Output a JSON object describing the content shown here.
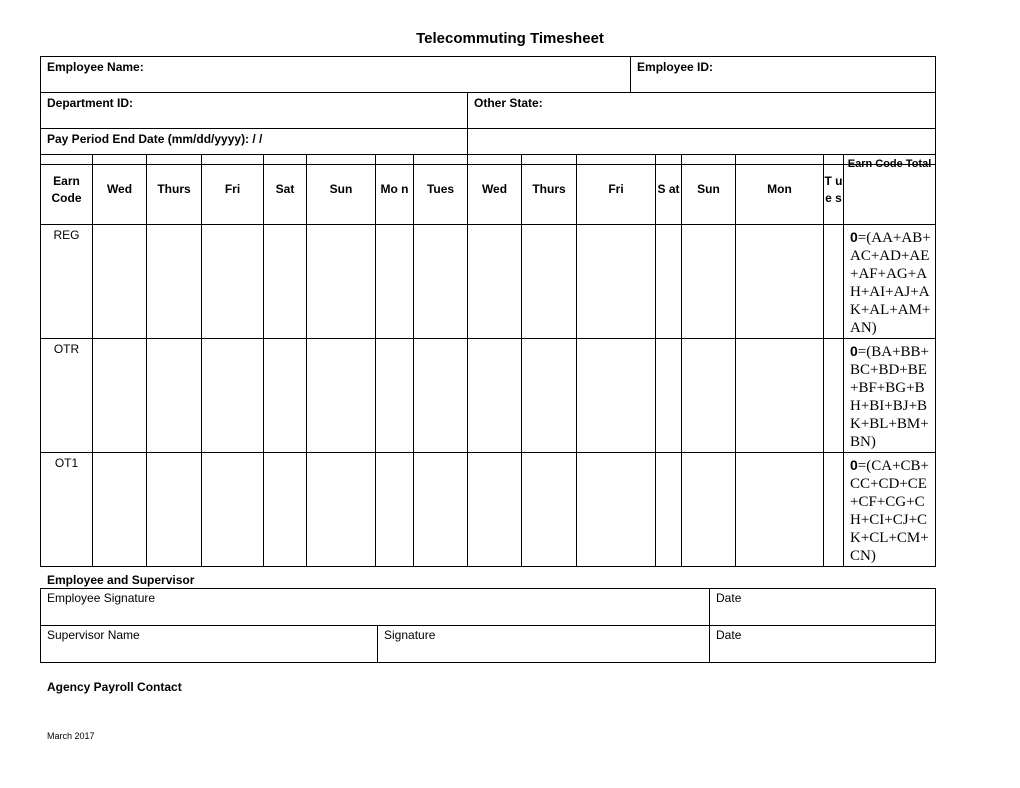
{
  "title": "Telecommuting Timesheet",
  "info": {
    "employee_name_label": "Employee Name:",
    "employee_id_label": "Employee ID:",
    "department_id_label": "Department ID:",
    "other_state_label": "Other State:",
    "pay_period_label": "Pay Period End Date (mm/dd/yyyy):   / /"
  },
  "grid": {
    "headers": [
      "Earn Code",
      "Wed",
      "Thurs",
      "Fri",
      "Sat",
      "Sun",
      "Mo n",
      "Tues",
      "Wed",
      "Thurs",
      "Fri",
      "S at",
      "Sun",
      "Mon",
      "T u e s",
      "Earn Code Total"
    ],
    "rows": [
      {
        "code": "REG",
        "total_value": "0",
        "formula": "=(AA+AB+AC+AD+AE+AF+AG+AH+AI+AJ+AK+AL+AM+AN)"
      },
      {
        "code": "OTR",
        "total_value": "0",
        "formula": "=(BA+BB+BC+BD+BE+BF+BG+BH+BI+BJ+BK+BL+BM+BN)"
      },
      {
        "code": "OT1",
        "total_value": "0",
        "formula": "=(CA+CB+CC+CD+CE+CF+CG+CH+CI+CJ+CK+CL+CM+CN)"
      }
    ]
  },
  "signatures": {
    "section_title": "Employee and Supervisor",
    "employee_signature_label": "Employee Signature",
    "date_label_1": "Date",
    "supervisor_name_label": "Supervisor Name",
    "signature_label": "Signature",
    "date_label_2": "Date"
  },
  "agency_payroll_contact": "Agency Payroll Contact",
  "footer_date": "March 2017"
}
